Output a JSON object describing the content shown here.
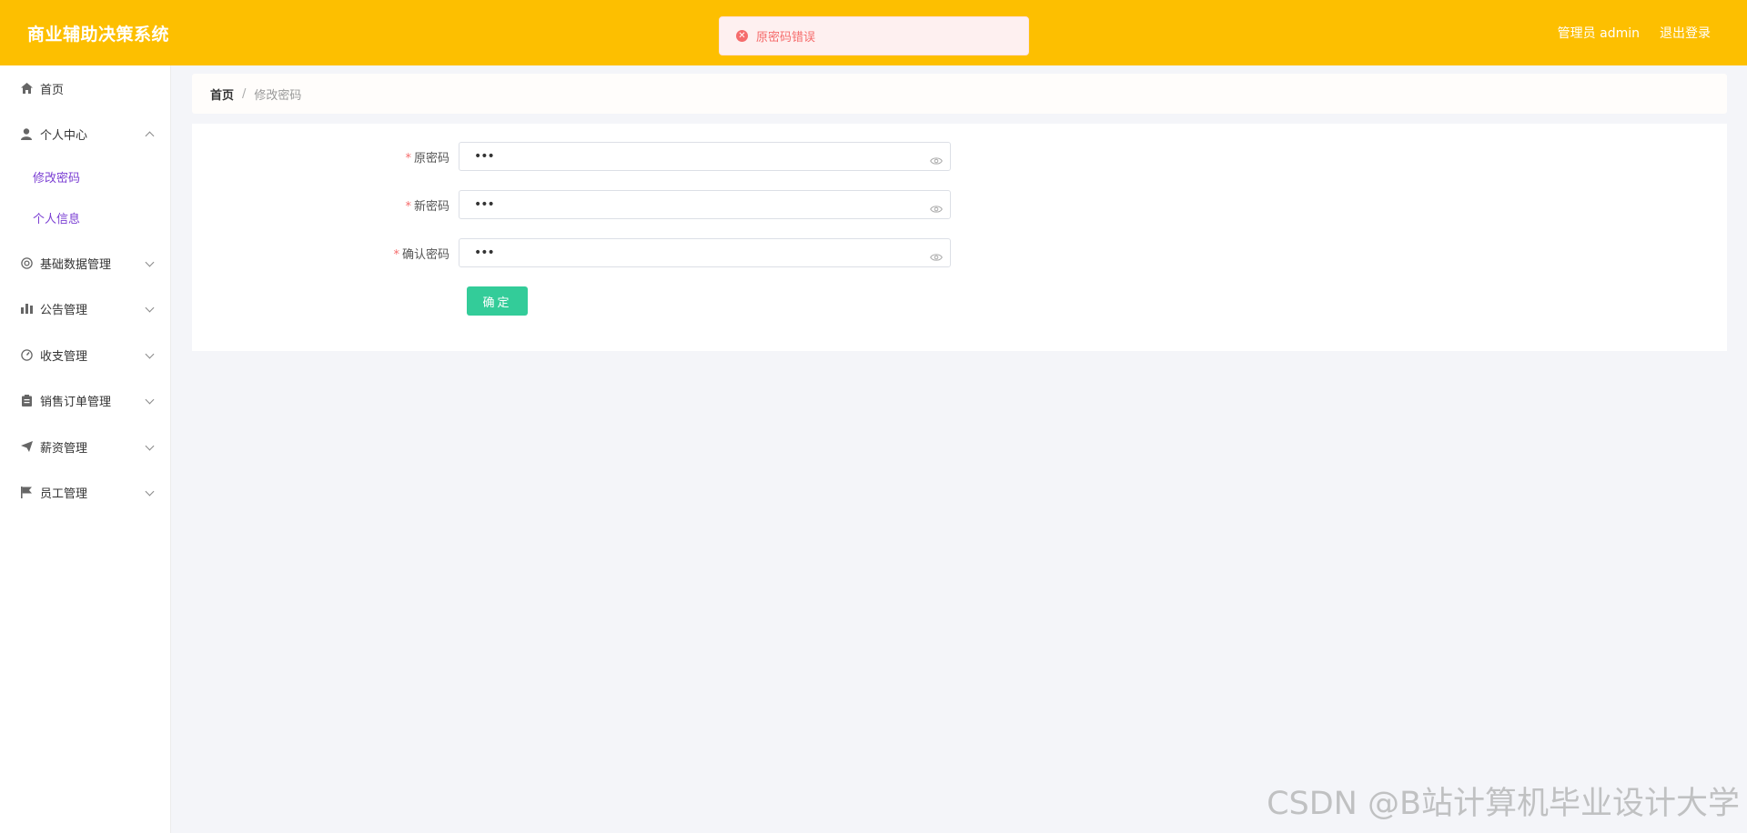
{
  "header": {
    "app_title": "商业辅助决策系统",
    "user_label": "管理员 admin",
    "logout_label": "退出登录",
    "background": "#fdbf00"
  },
  "toast": {
    "message": "原密码错误",
    "type": "error",
    "color": "#f56c6c"
  },
  "sidebar": {
    "items": [
      {
        "label": "首页",
        "icon": "home-icon"
      },
      {
        "label": "个人中心",
        "icon": "user-icon",
        "expanded": true
      },
      {
        "label": "基础数据管理",
        "icon": "gear-circle-icon"
      },
      {
        "label": "公告管理",
        "icon": "bar-chart-icon"
      },
      {
        "label": "收支管理",
        "icon": "gauge-icon"
      },
      {
        "label": "销售订单管理",
        "icon": "clipboard-icon"
      },
      {
        "label": "薪资管理",
        "icon": "paper-plane-icon"
      },
      {
        "label": "员工管理",
        "icon": "flag-icon"
      }
    ],
    "sub_items": [
      {
        "label": "修改密码"
      },
      {
        "label": "个人信息"
      }
    ],
    "sub_color": "#7b3fd3"
  },
  "breadcrumb": {
    "home": "首页",
    "separator": "/",
    "current": "修改密码"
  },
  "form": {
    "fields": [
      {
        "label": "原密码",
        "value": "•••",
        "required": true
      },
      {
        "label": "新密码",
        "value": "•••",
        "required": true
      },
      {
        "label": "确认密码",
        "value": "•••",
        "required": true
      }
    ],
    "submit_label": "确定",
    "submit_color": "#33cc99"
  },
  "watermark": "CSDN @B站计算机毕业设计大学"
}
